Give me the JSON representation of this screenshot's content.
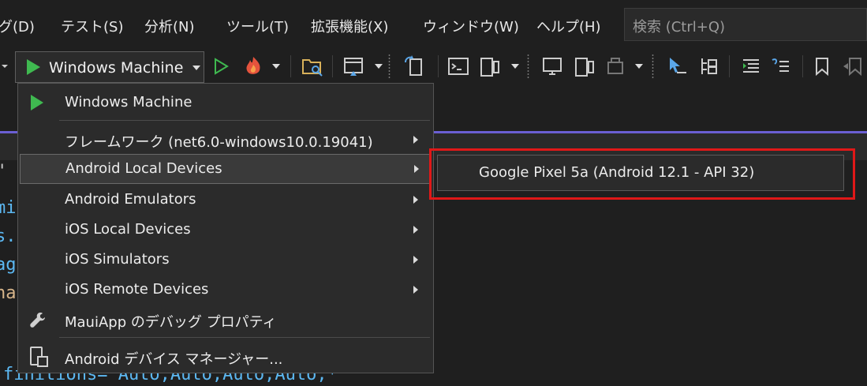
{
  "menubar": {
    "items": [
      "グ(D)",
      "テスト(S)",
      "分析(N)",
      "ツール(T)",
      "拡張機能(X)",
      "ウィンドウ(W)",
      "ヘルプ(H)"
    ],
    "search_placeholder": "検索 (Ctrl+Q)"
  },
  "toolbar": {
    "target_label": "Windows Machine",
    "icons": [
      "play-icon",
      "start-without-debugging-icon",
      "hot-reload-icon",
      "open-folder-icon",
      "xaml-designer-icon",
      "terminal-icon",
      "device-icon",
      "bookmark-icon"
    ]
  },
  "dropdown": {
    "items": [
      {
        "label": "Windows Machine",
        "icon": "play-icon",
        "submenu": false
      },
      {
        "label": "フレームワーク (net6.0-windows10.0.19041)",
        "submenu": true
      },
      {
        "label": "Android Local Devices",
        "submenu": true,
        "active": true
      },
      {
        "label": "Android Emulators",
        "submenu": true
      },
      {
        "label": "iOS Local Devices",
        "submenu": true
      },
      {
        "label": "iOS Simulators",
        "submenu": true
      },
      {
        "label": "iOS Remote Devices",
        "submenu": true
      },
      {
        "label": "MauiApp のデバッグ プロパティ",
        "icon": "wrench-icon",
        "submenu": false
      },
      {
        "label": "Android デバイス マネージャー...",
        "icon": "device-manager-icon",
        "submenu": false
      }
    ]
  },
  "submenu": {
    "items": [
      {
        "label": "Google Pixel 5a (Android 12.1 - API 32)"
      }
    ]
  },
  "editor": {
    "lines": [
      "\"",
      "mi",
      "s.",
      "ag",
      "na",
      "finitions=\"Auto,Auto,Auto,Auto,*\""
    ]
  },
  "colors": {
    "accent_green": "#3fb950",
    "highlight_red": "#e01818",
    "purple_line": "#6b5fd3"
  }
}
